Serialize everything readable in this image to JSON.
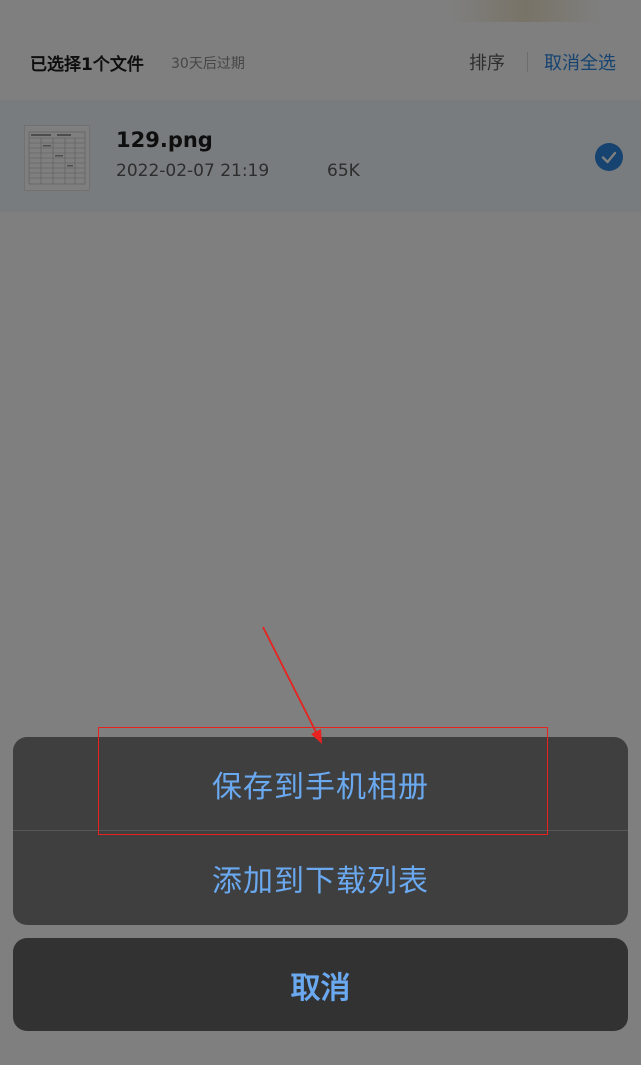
{
  "header": {
    "selected_title": "已选择1个文件",
    "expire_note": "30天后过期",
    "sort_label": "排序",
    "cancel_all_label": "取消全选"
  },
  "file": {
    "name": "129.png",
    "date": "2022-02-07 21:19",
    "size": "65K",
    "selected": true
  },
  "action_sheet": {
    "items": [
      {
        "label": "保存到手机相册"
      },
      {
        "label": "添加到下载列表"
      }
    ],
    "cancel_label": "取消"
  },
  "colors": {
    "accent": "#2c86e0",
    "sheet_text": "#6aa8f0",
    "annotation": "#e8231f"
  },
  "icons": {
    "check": "check-circle-icon",
    "thumbnail": "file-thumbnail"
  }
}
